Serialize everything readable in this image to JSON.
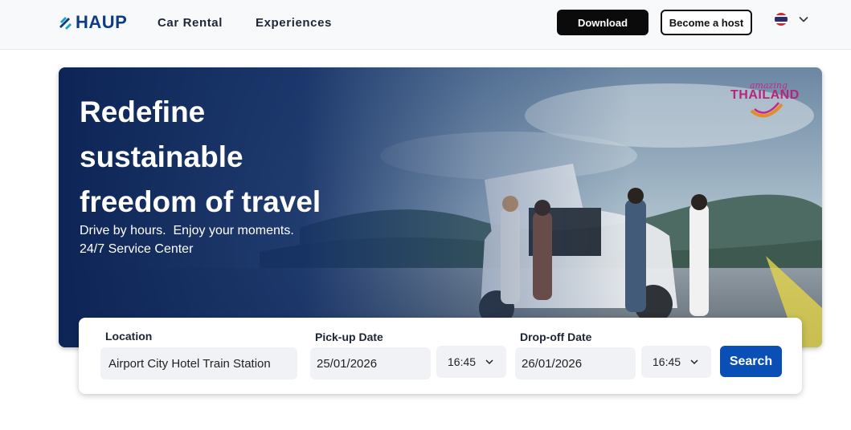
{
  "header": {
    "logo_text": "HAUP",
    "nav": [
      {
        "label": "Car Rental"
      },
      {
        "label": "Experiences"
      }
    ],
    "download_label": "Download",
    "host_label": "Become a host",
    "language": "th"
  },
  "hero": {
    "title_lines": [
      "Redefine",
      "sustainable",
      "freedom of travel"
    ],
    "subtitle_lines": [
      "Drive by hours.  Enjoy your moments.",
      "24/7 Service Center"
    ],
    "badge_small": "amazing",
    "badge_big": "THAILAND"
  },
  "search": {
    "location_label": "Location",
    "location_value": "Airport City Hotel Train Station",
    "pickup_label": "Pick-up Date",
    "pickup_date": "25/01/2026",
    "pickup_time": "16:45",
    "dropoff_label": "Drop-off Date",
    "dropoff_date": "26/01/2026",
    "dropoff_time": "16:45",
    "search_label": "Search"
  },
  "colors": {
    "brand": "#0f3b82",
    "primary_button": "#0a4fb5",
    "dark_button": "#0b0b0c"
  }
}
